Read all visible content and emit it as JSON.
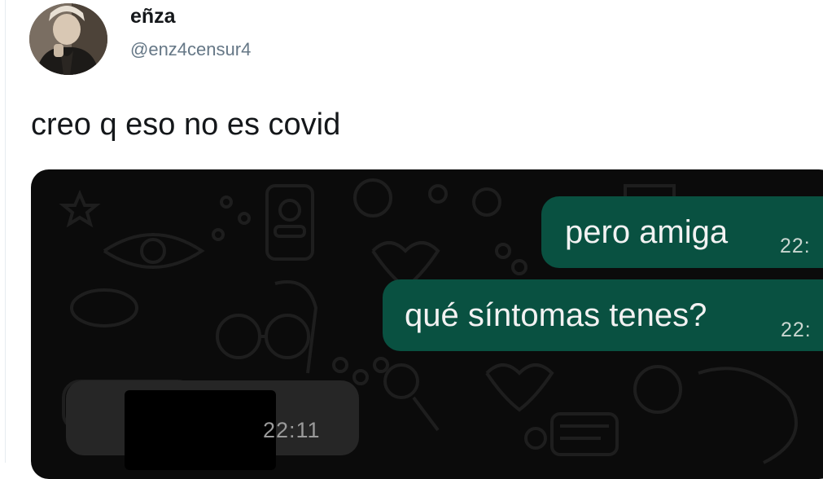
{
  "author": {
    "name": "eñza",
    "handle": "@enz4censur4"
  },
  "tweet": {
    "text": "creo q eso no es covid"
  },
  "chat": {
    "messages": [
      {
        "direction": "outgoing",
        "text": "pero amiga",
        "time": "22:"
      },
      {
        "direction": "outgoing",
        "text": "qué síntomas tenes?",
        "time": "22:"
      },
      {
        "direction": "incoming",
        "text": "",
        "time": "22:11",
        "redacted": true
      }
    ],
    "colors": {
      "background": "#0b0b0b",
      "outgoing_bubble": "#095141",
      "incoming_bubble": "#262626"
    }
  }
}
